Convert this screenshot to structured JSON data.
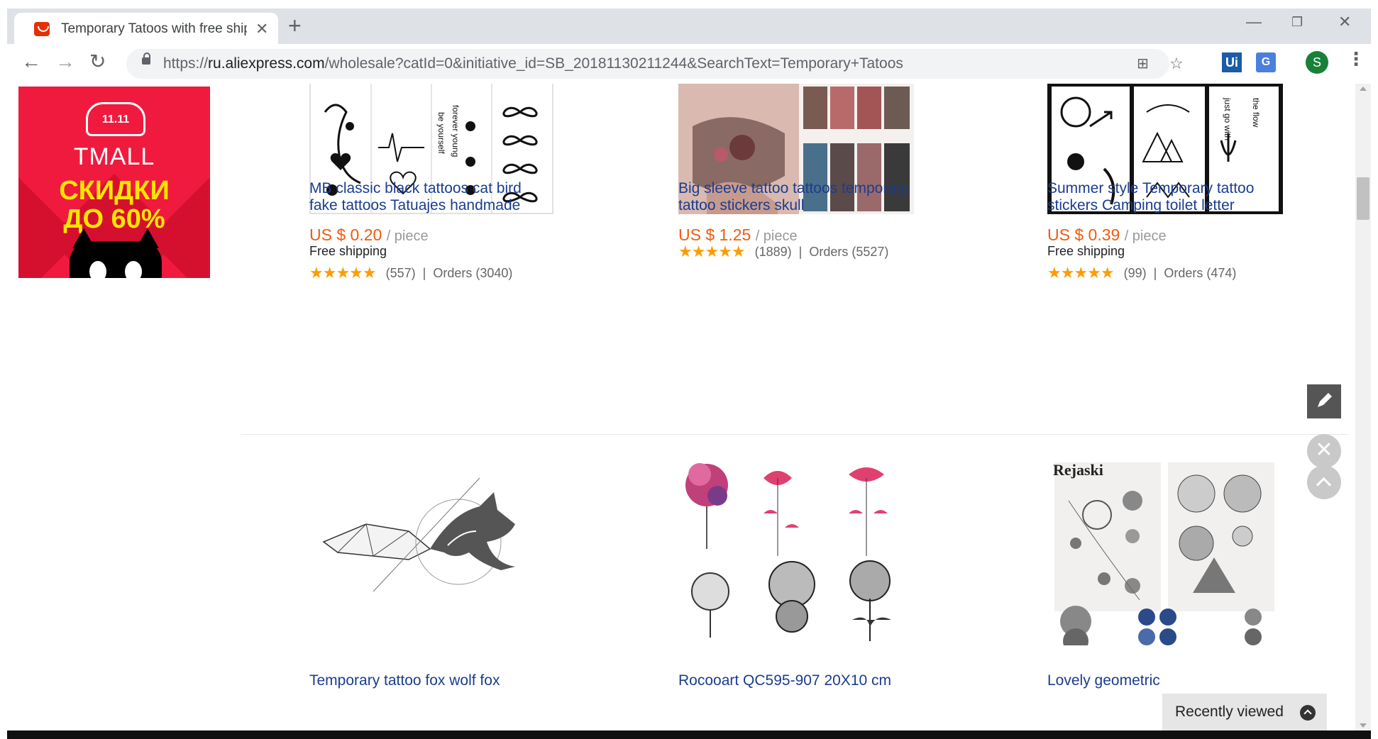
{
  "browser": {
    "tab_title": "Temporary Tatoos with free shipp",
    "url_prefix": "https://",
    "url_host": "ru.aliexpress.com",
    "url_path": "/wholesale?catId=0&initiative_id=SB_20181130211244&SearchText=Temporary+Tatoos",
    "profile_initial": "S",
    "ext_ui_label": "Ui",
    "ext_translate_label": "G"
  },
  "ad": {
    "logo_text": "11.11",
    "brand": "TMALL",
    "line1": "СКИДКИ",
    "line2": "ДО 60%"
  },
  "products": [
    {
      "title": "MB classic black tattoos cat bird fake tattoos Tatuajes handmade",
      "price": "US $ 0.20",
      "unit": "/ piece",
      "shipping": "Free shipping",
      "rating": 5,
      "reviews": "(557)",
      "orders": "Orders (3040)"
    },
    {
      "title": "Big sleeve tattoo tattoos temporary tattoo stickers skull",
      "price": "US $ 1.25",
      "unit": "/ piece",
      "shipping": "",
      "rating": 5,
      "reviews": "(1889)",
      "orders": "Orders (5527)"
    },
    {
      "title": "Summer style Temporary tattoo stickers Camping toilet letter",
      "price": "US $ 0.39",
      "unit": "/ piece",
      "shipping": "Free shipping",
      "rating": 5,
      "reviews": "(99)",
      "orders": "Orders (474)"
    },
    {
      "title": "Temporary tattoo fox wolf fox"
    },
    {
      "title": "Rocooart QC595-907 20X10 cm"
    },
    {
      "title": "Lovely geometric",
      "image_text": "Rejaski"
    }
  ],
  "widgets": {
    "recently_viewed": "Recently viewed",
    "close_glyph": "✕"
  },
  "colors": {
    "price": "#f35a0b",
    "title_link": "#1a3d8f",
    "star": "#ff9c00",
    "ad_red": "#f01a3e",
    "ad_yellow": "#ffe600"
  }
}
